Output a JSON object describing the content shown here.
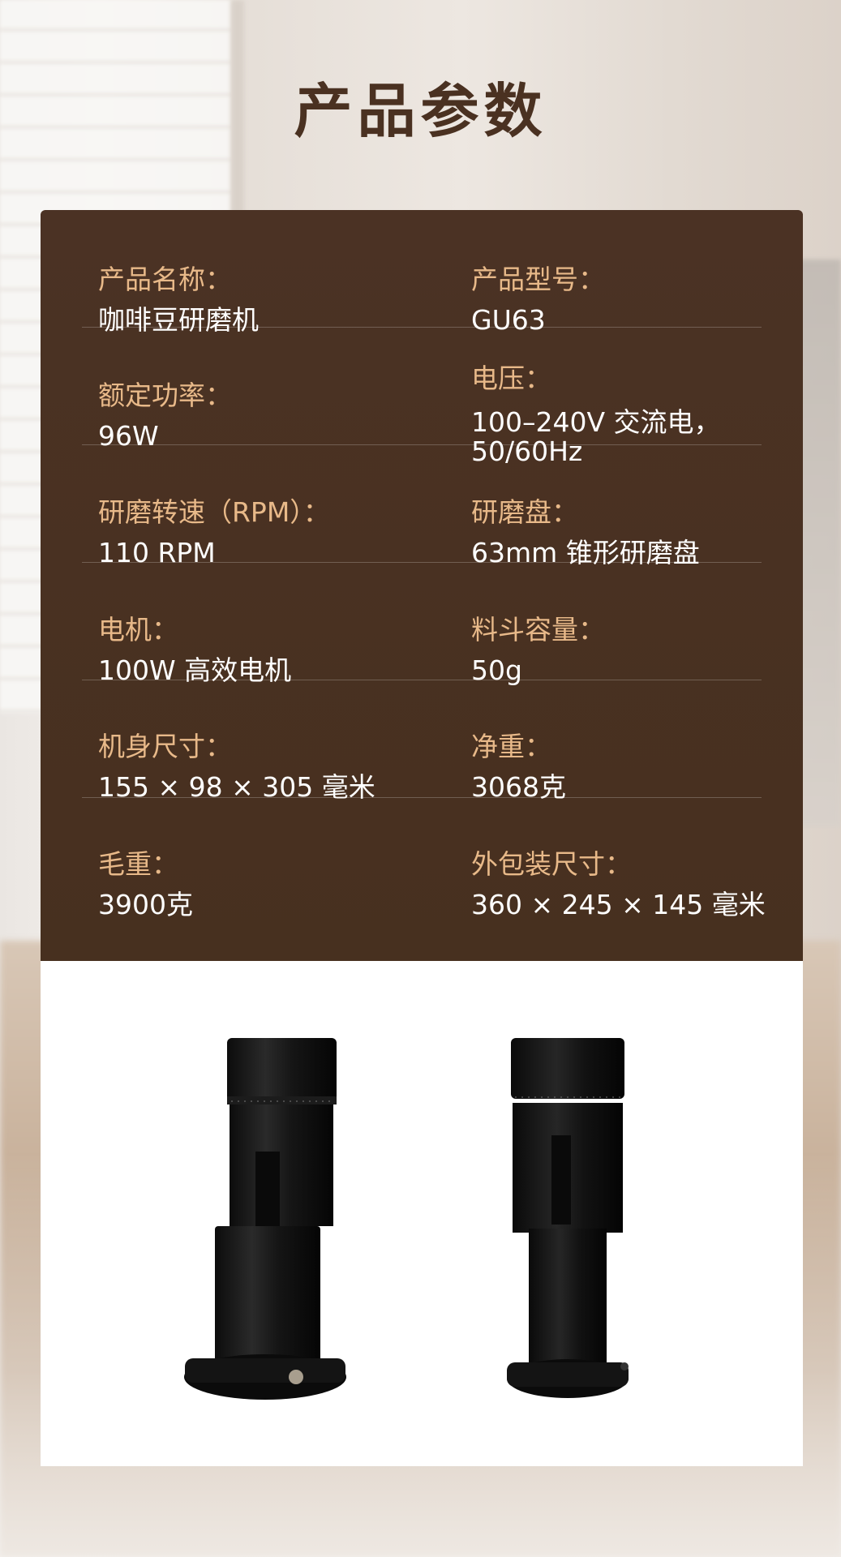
{
  "page_title": "产品参数",
  "specs": [
    {
      "left": {
        "label": "产品名称：",
        "value": "咖啡豆研磨机"
      },
      "right": {
        "label": "产品型号：",
        "value": "GU63"
      }
    },
    {
      "left": {
        "label": "额定功率：",
        "value": "96W"
      },
      "right": {
        "label": "电压：",
        "value": "100–240V 交流电，",
        "value2": "50/60Hz"
      }
    },
    {
      "left": {
        "label": "研磨转速（RPM）：",
        "value": "110 RPM"
      },
      "right": {
        "label": "研磨盘：",
        "value": "63mm 锥形研磨盘"
      }
    },
    {
      "left": {
        "label": "电机：",
        "value": "100W 高效电机"
      },
      "right": {
        "label": "料斗容量：",
        "value": "50g"
      }
    },
    {
      "left": {
        "label": "机身尺寸：",
        "value": "155 × 98 × 305 毫米"
      },
      "right": {
        "label": "净重：",
        "value": "3068克"
      }
    },
    {
      "left": {
        "label": "毛重：",
        "value": "3900克"
      },
      "right": {
        "label": "外包装尺寸：",
        "value": "360 × 245 × 145 毫米"
      }
    }
  ],
  "colors": {
    "title": "#4a3121",
    "card": "#4a3223",
    "label": "#e8b989",
    "value": "#ffffff"
  },
  "images": {
    "left_product": "coffee-grinder-with-cup",
    "right_product": "coffee-grinder"
  }
}
